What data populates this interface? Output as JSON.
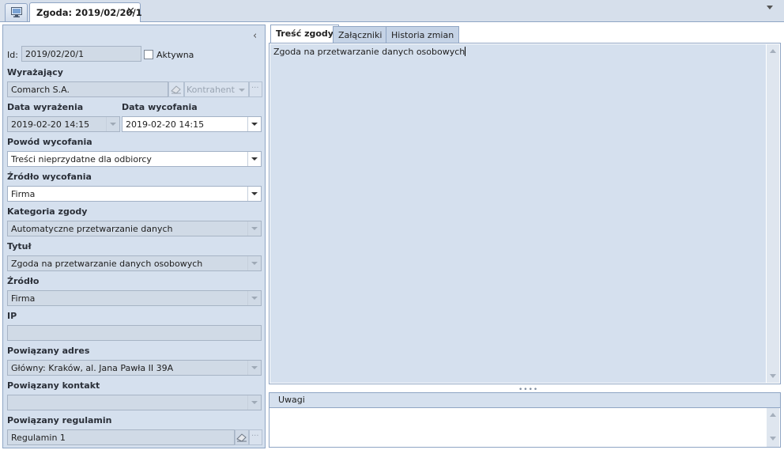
{
  "document_tab": {
    "title": "Zgoda: 2019/02/20/1",
    "close_glyph": "✕"
  },
  "icons": {
    "home": "monitor-icon",
    "collapse": "chevron-left-icon",
    "eraser": "eraser-icon",
    "dropdown": "dropdown-arrow-icon",
    "ellipsis": "ellipsis-icon"
  },
  "form": {
    "id_label": "Id:",
    "id_value": "2019/02/20/1",
    "active_label": "Aktywna",
    "active_checked": false,
    "party_label": "Wyrażający",
    "party_value": "Comarch S.A.",
    "party_type": "Kontrahent",
    "consent_date_label": "Data wyrażenia",
    "consent_date_value": "2019-02-20 14:15",
    "withdraw_date_label": "Data wycofania",
    "withdraw_date_value": "2019-02-20 14:15",
    "withdraw_reason_label": "Powód wycofania",
    "withdraw_reason_value": "Treści nieprzydatne dla odbiorcy",
    "withdraw_source_label": "Źródło wycofania",
    "withdraw_source_value": "Firma",
    "category_label": "Kategoria zgody",
    "category_value": "Automatyczne przetwarzanie danych",
    "title_label": "Tytuł",
    "title_value": "Zgoda na przetwarzanie danych osobowych",
    "source_label": "Źródło",
    "source_value": "Firma",
    "ip_label": "IP",
    "ip_value": "",
    "address_label": "Powiązany adres",
    "address_value": "Główny: Kraków, al. Jana Pawła II 39A",
    "contact_label": "Powiązany kontakt",
    "contact_value": "",
    "regulation_label": "Powiązany regulamin",
    "regulation_value": "Regulamin 1",
    "ellipsis": "···"
  },
  "right_tabs": [
    {
      "label": "Treść zgody",
      "active": true
    },
    {
      "label": "Załączniki",
      "active": false
    },
    {
      "label": "Historia zmian",
      "active": false
    }
  ],
  "content_text": "Zgoda na przetwarzanie danych osobowych",
  "splitter_glyph": "••••",
  "notes_label": "Uwagi",
  "notes_value": ""
}
